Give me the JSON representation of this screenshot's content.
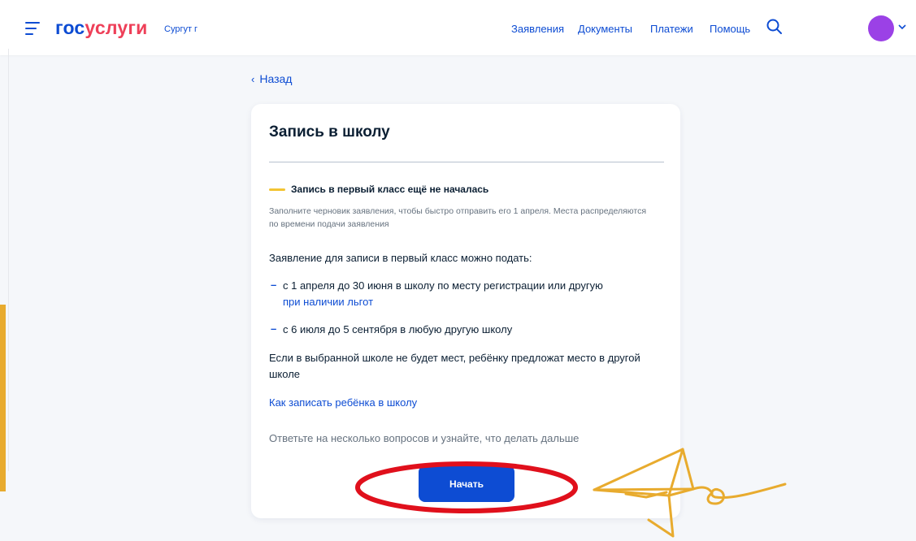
{
  "header": {
    "logo_part1": "гос",
    "logo_part2": "услуги",
    "city": "Сургут г",
    "nav": [
      "Заявления",
      "Документы",
      "Платежи",
      "Помощь"
    ]
  },
  "back_label": "Назад",
  "card": {
    "title": "Запись в школу",
    "status": {
      "title": "Запись в первый класс ещё не началась",
      "description": "Заполните черновик заявления, чтобы быстро отправить его 1 апреля. Места распределяются по времени подачи заявления",
      "marker_color": "#f3c433"
    },
    "intro": "Заявление для записи в первый класс можно подать:",
    "bullets": [
      {
        "text": "с 1 апреля до 30 июня в школу по месту регистрации или другую",
        "link": "при наличии льгот"
      },
      {
        "text": "с 6 июля до 5 сентября в любую другую школу"
      }
    ],
    "note": "Если в выбранной школе не будет мест, ребёнку предложат место в другой школе",
    "guide_link": "Как записать ребёнка в школу",
    "hint": "Ответьте на несколько вопросов и узнайте, что делать дальше",
    "start_button": "Начать"
  },
  "colors": {
    "brand_blue": "#0d4cd3",
    "brand_red": "#ee3f58",
    "avatar": "#9b41e6",
    "highlight_ellipse": "#e0101c",
    "arrow": "#e8ab2e"
  },
  "icons": [
    "menu-icon",
    "search-icon",
    "chevron-down-icon",
    "chevron-left-icon",
    "paper-plane-arrow-icon"
  ]
}
